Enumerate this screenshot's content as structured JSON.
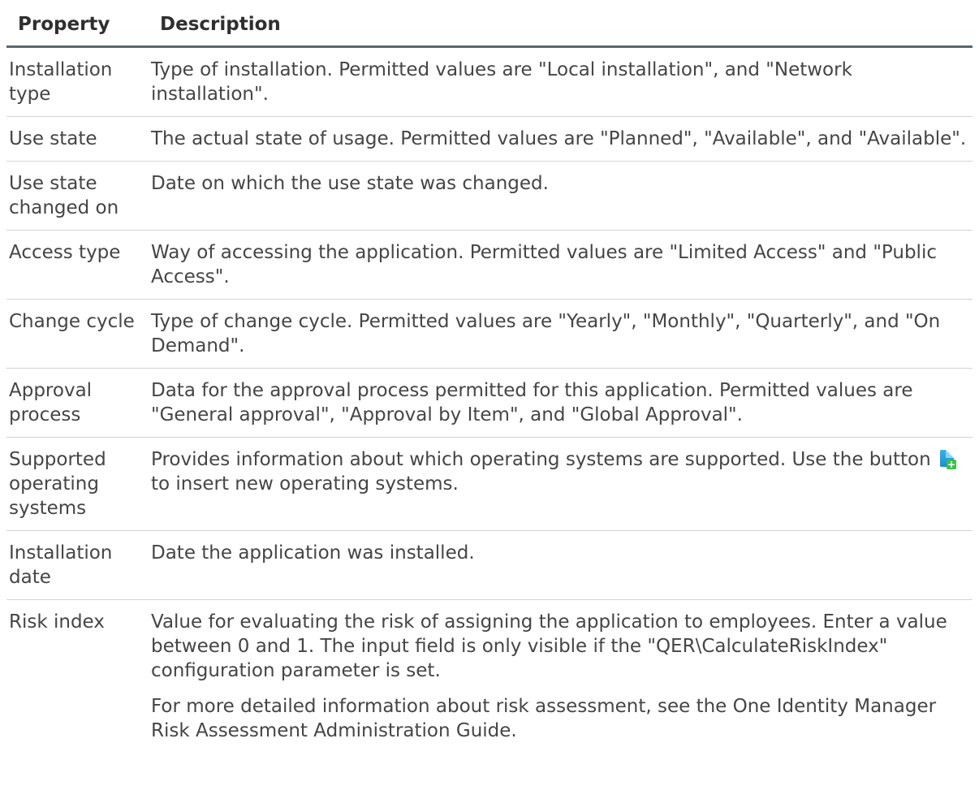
{
  "table": {
    "header": {
      "property": "Property",
      "description": "Description"
    },
    "rows": [
      {
        "property": "Installation type",
        "description": "Type of installation. Permitted values are \"Local installation\", and \"Network installation\"."
      },
      {
        "property": "Use state",
        "description": "The actual state of usage. Permitted values are \"Planned\", \"Available\", and \"Available\"."
      },
      {
        "property": "Use state changed on",
        "description": "Date on which the use state was changed."
      },
      {
        "property": "Access type",
        "description": "Way of accessing the application. Permitted values are \"Limited Access\" and \"Public Access\"."
      },
      {
        "property": "Change cycle",
        "description": "Type of change cycle. Permitted values are \"Yearly\", \"Monthly\", \"Quarterly\", and \"On Demand\"."
      },
      {
        "property": "Approval process",
        "description": "Data for the approval process permitted for this application. Permitted values are \"General approval\", \"Approval by Item\", and \"Global Approval\"."
      },
      {
        "property": "Supported operating systems",
        "description_before_icon": "Provides information about which operating systems are supported. Use the button",
        "icon": "add-item-icon",
        "description_after_icon": "to insert new operating systems."
      },
      {
        "property": "Installation date",
        "description": "Date the application was installed."
      },
      {
        "property": "Risk index",
        "description": "Value for evaluating the risk of assigning the application to employees. Enter a value between 0 and 1. The input field is only visible if the \"QER\\CalculateRiskIndex\" configuration parameter is set.",
        "note": "For more detailed information about risk assessment, see the One Identity Manager Risk Assessment Administration Guide."
      }
    ]
  }
}
